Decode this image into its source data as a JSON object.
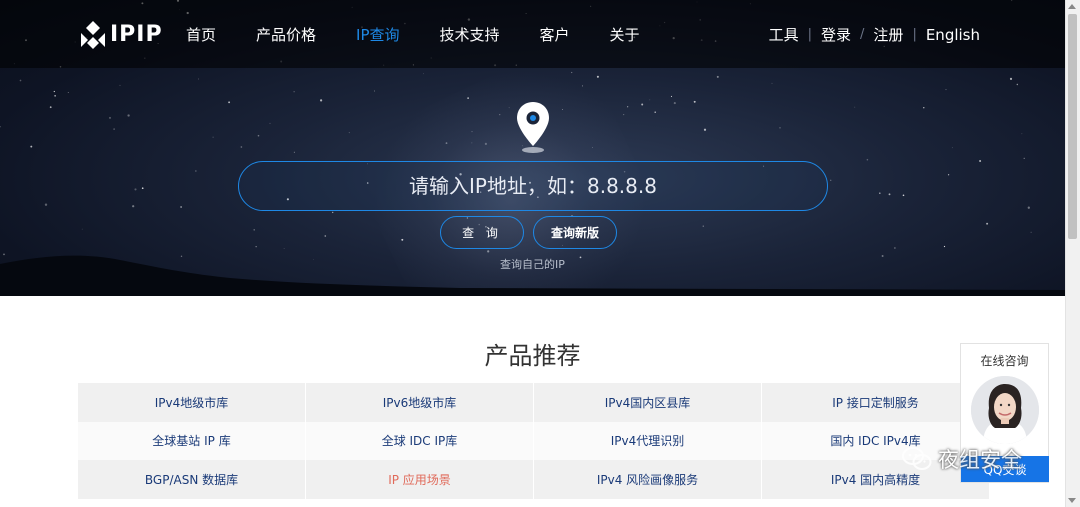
{
  "nav": {
    "logo_text": "IPIP",
    "items": [
      {
        "label": "首页",
        "active": false
      },
      {
        "label": "产品价格",
        "active": false
      },
      {
        "label": "IP查询",
        "active": true
      },
      {
        "label": "技术支持",
        "active": false
      },
      {
        "label": "客户",
        "active": false
      },
      {
        "label": "关于",
        "active": false
      }
    ],
    "right": {
      "tools": "工具",
      "login": "登录",
      "register": "注册",
      "english": "English"
    },
    "active_color": "#1e88e5"
  },
  "hero": {
    "icon": "location-pin-icon",
    "search_placeholder": "请输入IP地址，如：8.8.8.8",
    "query_button": "查 询",
    "new_query_button": "查询新版",
    "own_ip_link": "查询自己的IP"
  },
  "products": {
    "title": "产品推荐",
    "rows": [
      [
        "IPv4地级市库",
        "IPv6地级市库",
        "IPv4国内区县库",
        "IP 接口定制服务"
      ],
      [
        "全球基站 IP 库",
        "全球 IDC IP库",
        "IPv4代理识别",
        "国内 IDC IPv4库"
      ],
      [
        "BGP/ASN 数据库",
        "IP 应用场景",
        "IPv4 风险画像服务",
        "IPv4 国内高精度"
      ]
    ],
    "highlight_color": "#e06a5a"
  },
  "chat": {
    "title": "在线咨询",
    "button": "QQ交谈"
  },
  "watermark": {
    "icon": "wechat-icon",
    "text": "夜组安全"
  }
}
